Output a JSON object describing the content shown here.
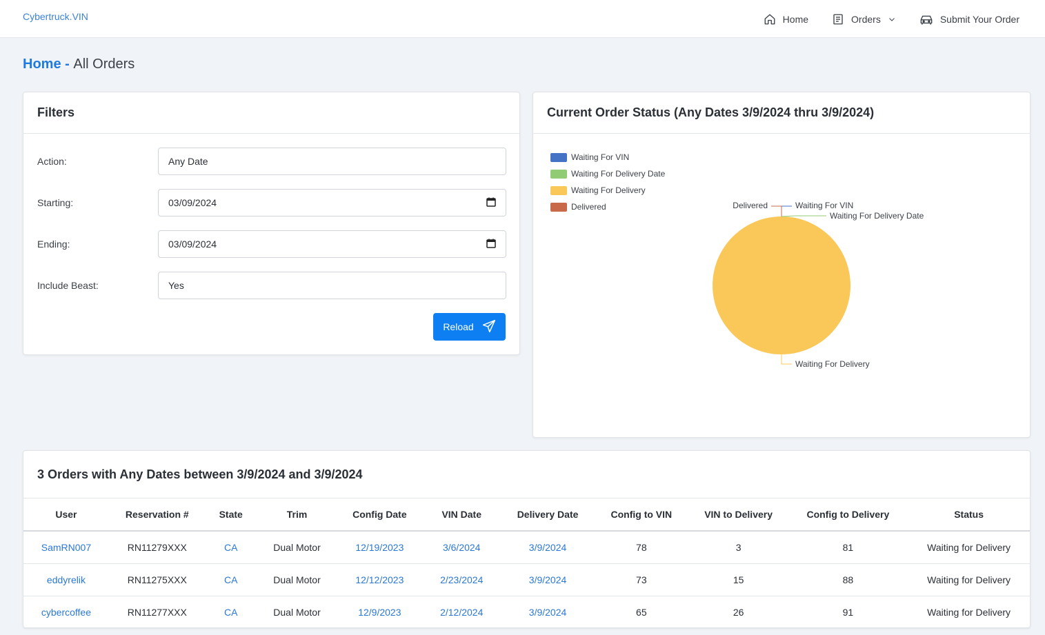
{
  "app": {
    "brand": "Cybertruck.VIN"
  },
  "nav": {
    "home": "Home",
    "orders": "Orders",
    "submit": "Submit Your Order"
  },
  "breadcrumb": {
    "home": "Home",
    "separator": " - ",
    "current": "All Orders"
  },
  "filters": {
    "title": "Filters",
    "action_label": "Action:",
    "action_value": "Any Date",
    "starting_label": "Starting:",
    "starting_value": "03/09/2024",
    "ending_label": "Ending:",
    "ending_value": "03/09/2024",
    "beast_label": "Include Beast:",
    "beast_value": "Yes",
    "reload_label": "Reload"
  },
  "status_card": {
    "title": "Current Order Status (Any Dates 3/9/2024 thru 3/9/2024)"
  },
  "chart_data": {
    "type": "pie",
    "title": "",
    "labels": [
      "Waiting For VIN",
      "Waiting For Delivery Date",
      "Waiting For Delivery",
      "Delivered"
    ],
    "values": [
      0,
      0,
      3,
      0
    ],
    "colors": [
      "#4472c4",
      "#91cc75",
      "#fac858",
      "#c8694a"
    ],
    "legend_position": "top-left"
  },
  "orders": {
    "title": "3 Orders with Any Dates between 3/9/2024 and 3/9/2024",
    "columns": [
      "User",
      "Reservation #",
      "State",
      "Trim",
      "Config Date",
      "VIN Date",
      "Delivery Date",
      "Config to VIN",
      "VIN to Delivery",
      "Config to Delivery",
      "Status"
    ],
    "rows": [
      [
        "SamRN007",
        "RN11279XXX",
        "CA",
        "Dual Motor",
        "12/19/2023",
        "3/6/2024",
        "3/9/2024",
        "78",
        "3",
        "81",
        "Waiting for Delivery"
      ],
      [
        "eddyrelik",
        "RN11275XXX",
        "CA",
        "Dual Motor",
        "12/12/2023",
        "2/23/2024",
        "3/9/2024",
        "73",
        "15",
        "88",
        "Waiting for Delivery"
      ],
      [
        "cybercoffee",
        "RN11277XXX",
        "CA",
        "Dual Motor",
        "12/9/2023",
        "2/12/2024",
        "3/9/2024",
        "65",
        "26",
        "91",
        "Waiting for Delivery"
      ]
    ]
  }
}
